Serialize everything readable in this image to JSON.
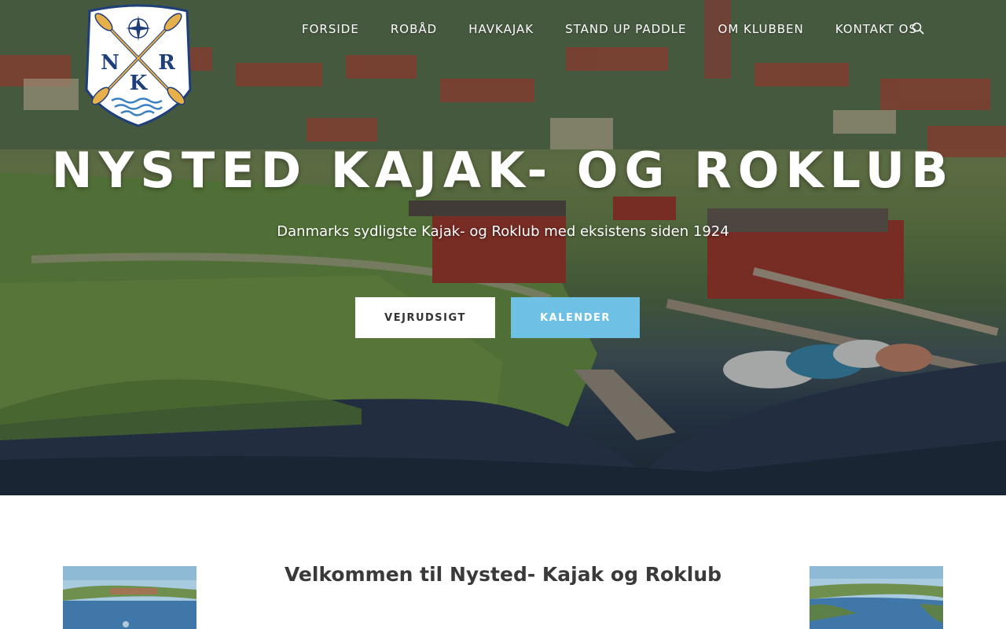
{
  "header": {
    "logo_letters": [
      "N",
      "R",
      "K"
    ],
    "nav": [
      {
        "label": "FORSIDE"
      },
      {
        "label": "ROBÅD"
      },
      {
        "label": "HAVKAJAK"
      },
      {
        "label": "STAND UP PADDLE"
      },
      {
        "label": "OM KLUBBEN"
      },
      {
        "label": "KONTAKT OS"
      }
    ],
    "search_icon": "search-icon"
  },
  "hero": {
    "title": "NYSTED KAJAK- OG ROKLUB",
    "subtitle": "Danmarks sydligste Kajak- og Roklub med eksistens siden 1924",
    "buttons": {
      "weather": "VEJRUDSIGT",
      "calendar": "KALENDER"
    }
  },
  "content": {
    "welcome": "Velkommen til Nysted- Kajak og Roklub"
  },
  "colors": {
    "accent": "#6ec1e4",
    "logo_blue": "#1f3f7a",
    "oar_gold": "#e8b04a"
  }
}
